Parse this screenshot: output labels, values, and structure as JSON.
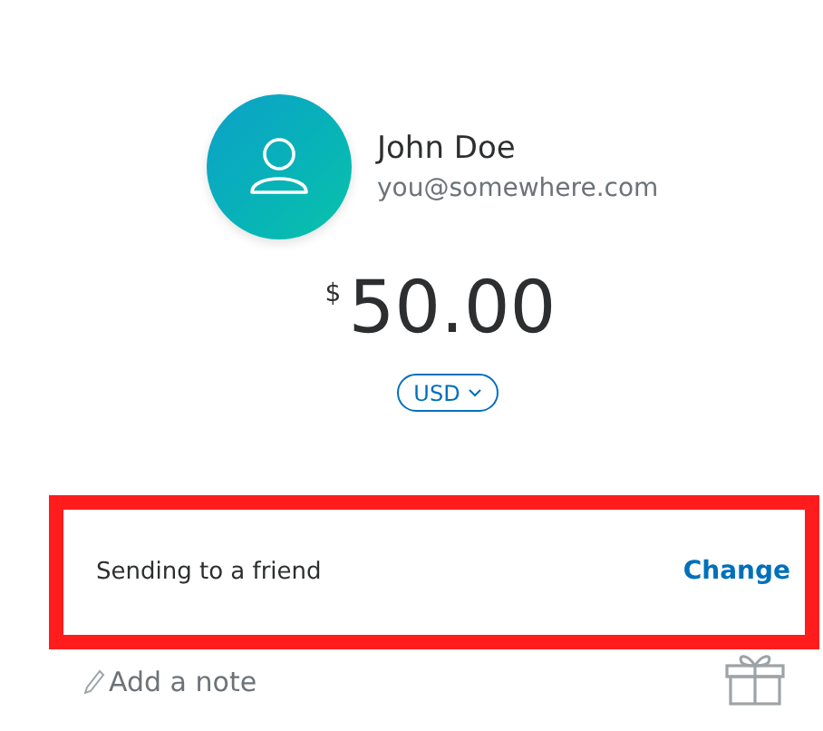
{
  "recipient": {
    "name": "John Doe",
    "email": "you@somewhere.com"
  },
  "amount": {
    "currency_symbol": "$",
    "value": "50.00"
  },
  "currency_selector": {
    "label": "USD"
  },
  "payment_type": {
    "label": "Sending to a friend",
    "action": "Change",
    "highlighted": true
  },
  "note": {
    "placeholder": "Add a note"
  }
}
